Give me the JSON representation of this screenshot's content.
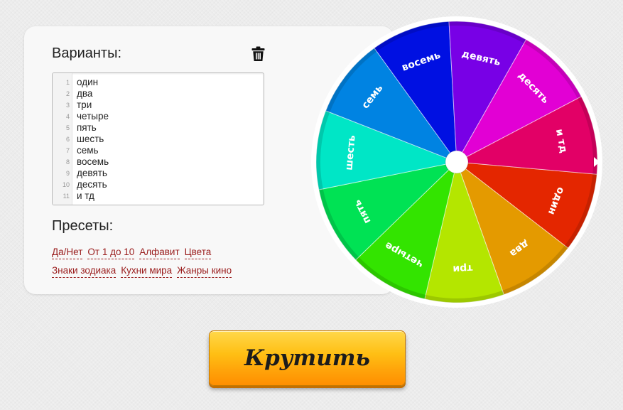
{
  "options_panel": {
    "heading": "Варианты:",
    "clear_icon": "trash-icon",
    "lines": [
      "один",
      "два",
      "три",
      "четыре",
      "пять",
      "шесть",
      "семь",
      "восемь",
      "девять",
      "десять",
      "и тд"
    ],
    "line_numbers": [
      "1",
      "2",
      "3",
      "4",
      "5",
      "6",
      "7",
      "8",
      "9",
      "10",
      "11"
    ]
  },
  "presets": {
    "heading": "Пресеты:",
    "rows": [
      [
        "Да/Нет",
        "От 1 до 10",
        "Алфавит",
        "Цвета"
      ],
      [
        "Знаки зодиака",
        "Кухни мира",
        "Жанры кино"
      ]
    ],
    "link_color": "#9a1d1d"
  },
  "wheel": {
    "start_angle_deg": 5,
    "segments": [
      {
        "label": "один",
        "color": "#e42600"
      },
      {
        "label": "два",
        "color": "#e49a00"
      },
      {
        "label": "три",
        "color": "#b4e600"
      },
      {
        "label": "четыре",
        "color": "#33e400"
      },
      {
        "label": "пять",
        "color": "#00e254"
      },
      {
        "label": "шесть",
        "color": "#00e6c6"
      },
      {
        "label": "семь",
        "color": "#0083e2"
      },
      {
        "label": "восемь",
        "color": "#0010e2"
      },
      {
        "label": "девять",
        "color": "#7800e6"
      },
      {
        "label": "десять",
        "color": "#e200d4"
      },
      {
        "label": "и тд",
        "color": "#e20066"
      }
    ]
  },
  "spin_button": {
    "label": "Крутить"
  }
}
